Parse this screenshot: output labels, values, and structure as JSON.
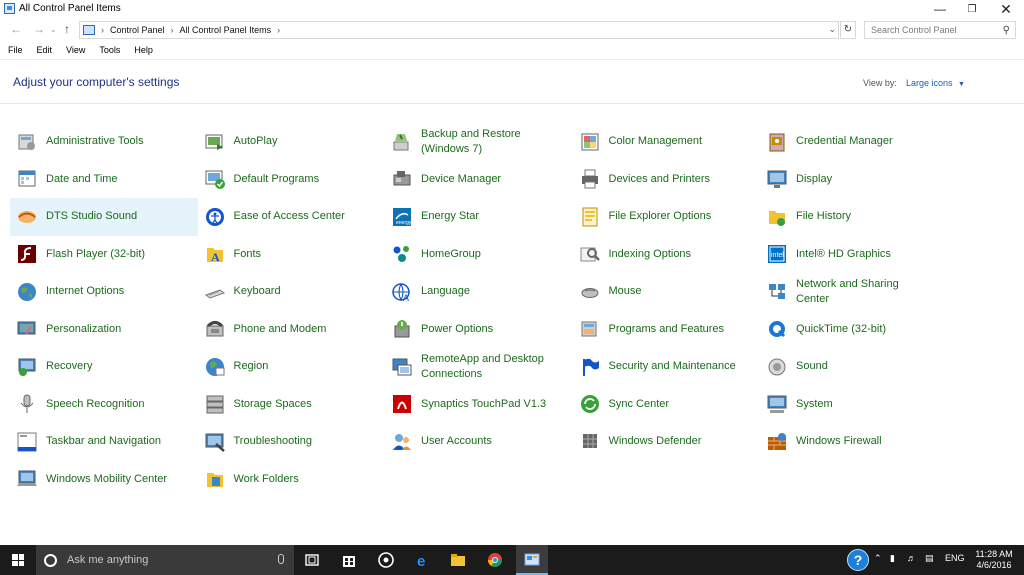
{
  "window": {
    "title": "All Control Panel Items"
  },
  "address": {
    "crumbs": [
      "Control Panel",
      "All Control Panel Items"
    ],
    "search_placeholder": "Search Control Panel"
  },
  "menu": [
    "File",
    "Edit",
    "View",
    "Tools",
    "Help"
  ],
  "header": {
    "title": "Adjust your computer's settings",
    "view_by_label": "View by:",
    "view_by_value": "Large icons"
  },
  "items": [
    {
      "label": "Administrative Tools",
      "icon": "admin-tools-icon"
    },
    {
      "label": "AutoPlay",
      "icon": "autoplay-icon"
    },
    {
      "label": "Backup and Restore (Windows 7)",
      "icon": "backup-icon"
    },
    {
      "label": "Color Management",
      "icon": "color-management-icon"
    },
    {
      "label": "Credential Manager",
      "icon": "credential-icon"
    },
    {
      "label": "Date and Time",
      "icon": "date-time-icon"
    },
    {
      "label": "Default Programs",
      "icon": "default-programs-icon"
    },
    {
      "label": "Device Manager",
      "icon": "device-manager-icon"
    },
    {
      "label": "Devices and Printers",
      "icon": "printer-icon"
    },
    {
      "label": "Display",
      "icon": "display-icon"
    },
    {
      "label": "DTS Studio Sound",
      "icon": "dts-icon"
    },
    {
      "label": "Ease of Access Center",
      "icon": "ease-access-icon"
    },
    {
      "label": "Energy Star",
      "icon": "energy-star-icon"
    },
    {
      "label": "File Explorer Options",
      "icon": "folder-options-icon"
    },
    {
      "label": "File History",
      "icon": "file-history-icon"
    },
    {
      "label": "Flash Player (32-bit)",
      "icon": "flash-icon"
    },
    {
      "label": "Fonts",
      "icon": "fonts-icon"
    },
    {
      "label": "HomeGroup",
      "icon": "homegroup-icon"
    },
    {
      "label": "Indexing Options",
      "icon": "indexing-icon"
    },
    {
      "label": "Intel® HD Graphics",
      "icon": "intel-graphics-icon"
    },
    {
      "label": "Internet Options",
      "icon": "internet-icon"
    },
    {
      "label": "Keyboard",
      "icon": "keyboard-icon"
    },
    {
      "label": "Language",
      "icon": "language-icon"
    },
    {
      "label": "Mouse",
      "icon": "mouse-icon"
    },
    {
      "label": "Network and Sharing Center",
      "icon": "network-icon"
    },
    {
      "label": "Personalization",
      "icon": "personalization-icon"
    },
    {
      "label": "Phone and Modem",
      "icon": "phone-icon"
    },
    {
      "label": "Power Options",
      "icon": "power-icon"
    },
    {
      "label": "Programs and Features",
      "icon": "programs-icon"
    },
    {
      "label": "QuickTime (32-bit)",
      "icon": "quicktime-icon"
    },
    {
      "label": "Recovery",
      "icon": "recovery-icon"
    },
    {
      "label": "Region",
      "icon": "region-icon"
    },
    {
      "label": "RemoteApp and Desktop Connections",
      "icon": "remoteapp-icon"
    },
    {
      "label": "Security and Maintenance",
      "icon": "flag-icon"
    },
    {
      "label": "Sound",
      "icon": "sound-icon"
    },
    {
      "label": "Speech Recognition",
      "icon": "microphone-icon"
    },
    {
      "label": "Storage Spaces",
      "icon": "storage-icon"
    },
    {
      "label": "Synaptics TouchPad V1.3",
      "icon": "synaptics-icon"
    },
    {
      "label": "Sync Center",
      "icon": "sync-icon"
    },
    {
      "label": "System",
      "icon": "system-icon"
    },
    {
      "label": "Taskbar and Navigation",
      "icon": "taskbar-icon"
    },
    {
      "label": "Troubleshooting",
      "icon": "troubleshooting-icon"
    },
    {
      "label": "User Accounts",
      "icon": "user-accounts-icon"
    },
    {
      "label": "Windows Defender",
      "icon": "defender-icon"
    },
    {
      "label": "Windows Firewall",
      "icon": "firewall-icon"
    },
    {
      "label": "Windows Mobility Center",
      "icon": "mobility-icon"
    },
    {
      "label": "Work Folders",
      "icon": "work-folders-icon"
    }
  ],
  "selected_item": "DTS Studio Sound",
  "taskbar": {
    "search_placeholder": "Ask me anything",
    "language": "ENG",
    "time": "11:28 AM",
    "date": "4/6/2016"
  },
  "colors": {
    "link_green": "#1c6b1c",
    "title_blue": "#1e3287",
    "taskbar": "#1b1b1b",
    "selection": "#e5f3fb"
  }
}
